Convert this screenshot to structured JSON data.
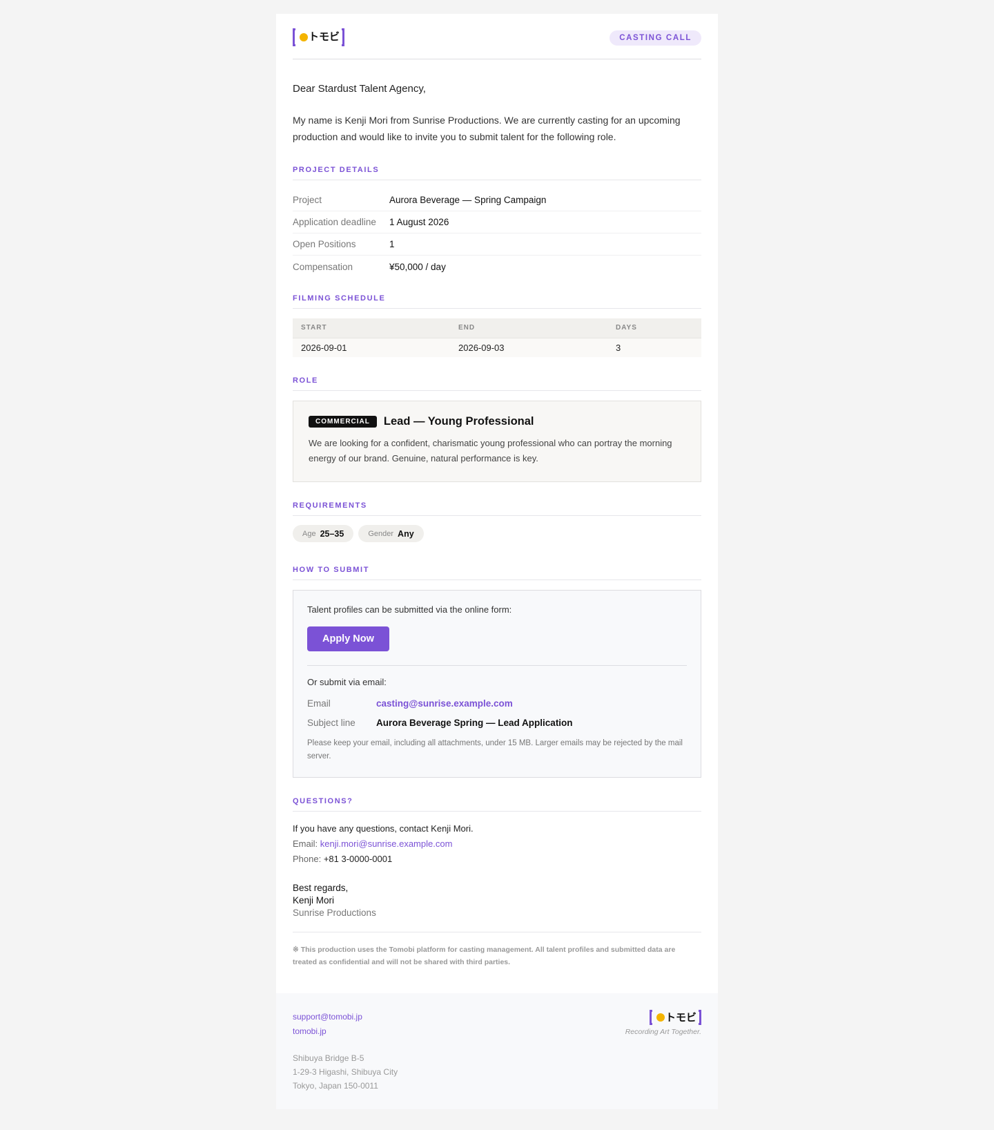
{
  "brand": {
    "logo_text": "トモビ",
    "tagline": "Recording Art Together."
  },
  "header": {
    "badge": "CASTING CALL"
  },
  "greeting": "Dear Stardust Talent Agency,",
  "intro": "My name is Kenji Mori from Sunrise Productions. We are currently casting for an upcoming production and would like to invite you to submit talent for the following role.",
  "project": {
    "title": "PROJECT DETAILS",
    "rows": [
      {
        "label": "Project",
        "value": "Aurora Beverage — Spring Campaign"
      },
      {
        "label": "Application deadline",
        "value": "1 August 2026"
      },
      {
        "label": "Open Positions",
        "value": "1"
      },
      {
        "label": "Compensation",
        "value": "¥50,000 / day"
      }
    ]
  },
  "schedule": {
    "title": "FILMING SCHEDULE",
    "headers": [
      "START",
      "END",
      "DAYS"
    ],
    "row": [
      "2026-09-01",
      "2026-09-03",
      "3"
    ]
  },
  "role": {
    "title": "ROLE",
    "tag": "COMMERCIAL",
    "name": "Lead — Young Professional",
    "description": "We are looking for a confident, charismatic young professional who can portray the morning energy of our brand. Genuine, natural performance is key."
  },
  "requirements": {
    "title": "REQUIREMENTS",
    "items": [
      {
        "label": "Age",
        "value": "25–35"
      },
      {
        "label": "Gender",
        "value": "Any"
      }
    ]
  },
  "submit": {
    "title": "HOW TO SUBMIT",
    "lead": "Talent profiles can be submitted via the online form:",
    "button": "Apply Now",
    "or": "Or submit via email:",
    "email_label": "Email",
    "email_value": "casting@sunrise.example.com",
    "subject_label": "Subject line",
    "subject_value": "Aurora Beverage Spring — Lead Application",
    "note": "Please keep your email, including all attachments, under 15 MB. Larger emails may be rejected by the mail server."
  },
  "questions": {
    "title": "QUESTIONS?",
    "line": "If you have any questions, contact Kenji Mori.",
    "email_label": "Email:",
    "email": "kenji.mori@sunrise.example.com",
    "phone_label": "Phone:",
    "phone": "+81 3-0000-0001"
  },
  "signoff": {
    "closing": "Best regards,",
    "name": "Kenji Mori",
    "org": "Sunrise Productions"
  },
  "disclaimer": "※ This production uses the Tomobi platform for casting management. All talent profiles and submitted data are treated as confidential and will not be shared with third parties.",
  "footer": {
    "support_email": "support@tomobi.jp",
    "site": "tomobi.jp",
    "address": [
      "Shibuya Bridge B-5",
      "1-29-3 Higashi, Shibuya City",
      "Tokyo, Japan 150-0011"
    ]
  },
  "colors": {
    "accent": "#7b52d6",
    "logo_dot": "#f4b400"
  }
}
